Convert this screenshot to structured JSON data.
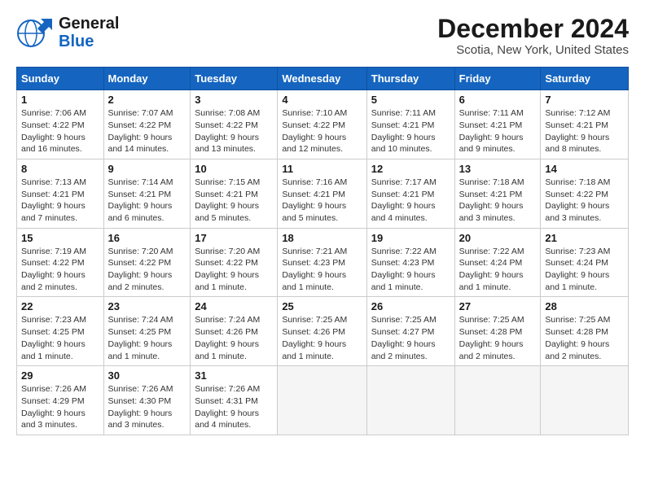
{
  "header": {
    "logo_line1": "General",
    "logo_line2": "Blue",
    "main_title": "December 2024",
    "sub_title": "Scotia, New York, United States"
  },
  "weekdays": [
    "Sunday",
    "Monday",
    "Tuesday",
    "Wednesday",
    "Thursday",
    "Friday",
    "Saturday"
  ],
  "weeks": [
    [
      {
        "day": "1",
        "sunrise": "Sunrise: 7:06 AM",
        "sunset": "Sunset: 4:22 PM",
        "daylight": "Daylight: 9 hours and 16 minutes."
      },
      {
        "day": "2",
        "sunrise": "Sunrise: 7:07 AM",
        "sunset": "Sunset: 4:22 PM",
        "daylight": "Daylight: 9 hours and 14 minutes."
      },
      {
        "day": "3",
        "sunrise": "Sunrise: 7:08 AM",
        "sunset": "Sunset: 4:22 PM",
        "daylight": "Daylight: 9 hours and 13 minutes."
      },
      {
        "day": "4",
        "sunrise": "Sunrise: 7:10 AM",
        "sunset": "Sunset: 4:22 PM",
        "daylight": "Daylight: 9 hours and 12 minutes."
      },
      {
        "day": "5",
        "sunrise": "Sunrise: 7:11 AM",
        "sunset": "Sunset: 4:21 PM",
        "daylight": "Daylight: 9 hours and 10 minutes."
      },
      {
        "day": "6",
        "sunrise": "Sunrise: 7:11 AM",
        "sunset": "Sunset: 4:21 PM",
        "daylight": "Daylight: 9 hours and 9 minutes."
      },
      {
        "day": "7",
        "sunrise": "Sunrise: 7:12 AM",
        "sunset": "Sunset: 4:21 PM",
        "daylight": "Daylight: 9 hours and 8 minutes."
      }
    ],
    [
      {
        "day": "8",
        "sunrise": "Sunrise: 7:13 AM",
        "sunset": "Sunset: 4:21 PM",
        "daylight": "Daylight: 9 hours and 7 minutes."
      },
      {
        "day": "9",
        "sunrise": "Sunrise: 7:14 AM",
        "sunset": "Sunset: 4:21 PM",
        "daylight": "Daylight: 9 hours and 6 minutes."
      },
      {
        "day": "10",
        "sunrise": "Sunrise: 7:15 AM",
        "sunset": "Sunset: 4:21 PM",
        "daylight": "Daylight: 9 hours and 5 minutes."
      },
      {
        "day": "11",
        "sunrise": "Sunrise: 7:16 AM",
        "sunset": "Sunset: 4:21 PM",
        "daylight": "Daylight: 9 hours and 5 minutes."
      },
      {
        "day": "12",
        "sunrise": "Sunrise: 7:17 AM",
        "sunset": "Sunset: 4:21 PM",
        "daylight": "Daylight: 9 hours and 4 minutes."
      },
      {
        "day": "13",
        "sunrise": "Sunrise: 7:18 AM",
        "sunset": "Sunset: 4:21 PM",
        "daylight": "Daylight: 9 hours and 3 minutes."
      },
      {
        "day": "14",
        "sunrise": "Sunrise: 7:18 AM",
        "sunset": "Sunset: 4:22 PM",
        "daylight": "Daylight: 9 hours and 3 minutes."
      }
    ],
    [
      {
        "day": "15",
        "sunrise": "Sunrise: 7:19 AM",
        "sunset": "Sunset: 4:22 PM",
        "daylight": "Daylight: 9 hours and 2 minutes."
      },
      {
        "day": "16",
        "sunrise": "Sunrise: 7:20 AM",
        "sunset": "Sunset: 4:22 PM",
        "daylight": "Daylight: 9 hours and 2 minutes."
      },
      {
        "day": "17",
        "sunrise": "Sunrise: 7:20 AM",
        "sunset": "Sunset: 4:22 PM",
        "daylight": "Daylight: 9 hours and 1 minute."
      },
      {
        "day": "18",
        "sunrise": "Sunrise: 7:21 AM",
        "sunset": "Sunset: 4:23 PM",
        "daylight": "Daylight: 9 hours and 1 minute."
      },
      {
        "day": "19",
        "sunrise": "Sunrise: 7:22 AM",
        "sunset": "Sunset: 4:23 PM",
        "daylight": "Daylight: 9 hours and 1 minute."
      },
      {
        "day": "20",
        "sunrise": "Sunrise: 7:22 AM",
        "sunset": "Sunset: 4:24 PM",
        "daylight": "Daylight: 9 hours and 1 minute."
      },
      {
        "day": "21",
        "sunrise": "Sunrise: 7:23 AM",
        "sunset": "Sunset: 4:24 PM",
        "daylight": "Daylight: 9 hours and 1 minute."
      }
    ],
    [
      {
        "day": "22",
        "sunrise": "Sunrise: 7:23 AM",
        "sunset": "Sunset: 4:25 PM",
        "daylight": "Daylight: 9 hours and 1 minute."
      },
      {
        "day": "23",
        "sunrise": "Sunrise: 7:24 AM",
        "sunset": "Sunset: 4:25 PM",
        "daylight": "Daylight: 9 hours and 1 minute."
      },
      {
        "day": "24",
        "sunrise": "Sunrise: 7:24 AM",
        "sunset": "Sunset: 4:26 PM",
        "daylight": "Daylight: 9 hours and 1 minute."
      },
      {
        "day": "25",
        "sunrise": "Sunrise: 7:25 AM",
        "sunset": "Sunset: 4:26 PM",
        "daylight": "Daylight: 9 hours and 1 minute."
      },
      {
        "day": "26",
        "sunrise": "Sunrise: 7:25 AM",
        "sunset": "Sunset: 4:27 PM",
        "daylight": "Daylight: 9 hours and 2 minutes."
      },
      {
        "day": "27",
        "sunrise": "Sunrise: 7:25 AM",
        "sunset": "Sunset: 4:28 PM",
        "daylight": "Daylight: 9 hours and 2 minutes."
      },
      {
        "day": "28",
        "sunrise": "Sunrise: 7:25 AM",
        "sunset": "Sunset: 4:28 PM",
        "daylight": "Daylight: 9 hours and 2 minutes."
      }
    ],
    [
      {
        "day": "29",
        "sunrise": "Sunrise: 7:26 AM",
        "sunset": "Sunset: 4:29 PM",
        "daylight": "Daylight: 9 hours and 3 minutes."
      },
      {
        "day": "30",
        "sunrise": "Sunrise: 7:26 AM",
        "sunset": "Sunset: 4:30 PM",
        "daylight": "Daylight: 9 hours and 3 minutes."
      },
      {
        "day": "31",
        "sunrise": "Sunrise: 7:26 AM",
        "sunset": "Sunset: 4:31 PM",
        "daylight": "Daylight: 9 hours and 4 minutes."
      },
      null,
      null,
      null,
      null
    ]
  ]
}
